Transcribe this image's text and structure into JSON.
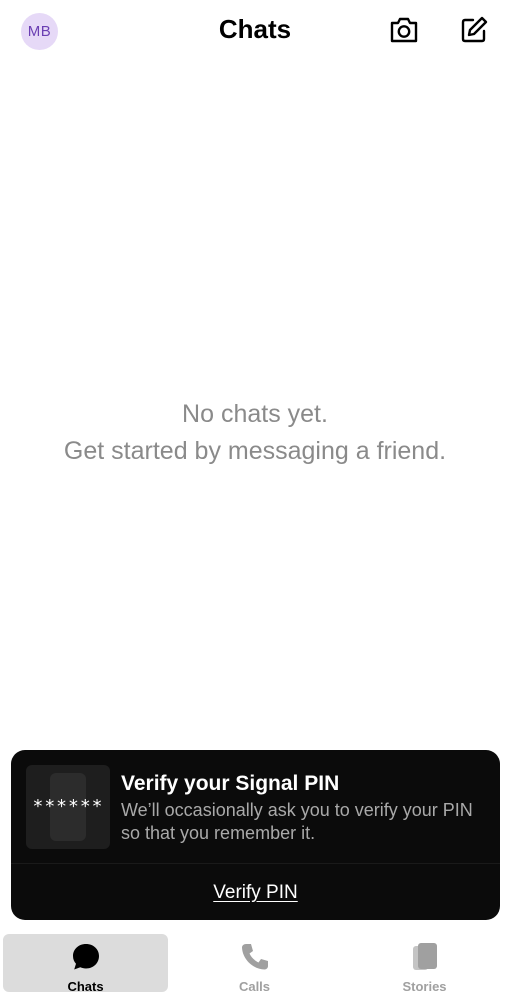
{
  "header": {
    "avatar_initials": "MB",
    "title": "Chats",
    "camera_icon": "camera-icon",
    "compose_icon": "compose-icon"
  },
  "empty_state": {
    "line1": "No chats yet.",
    "line2": "Get started by messaging a friend."
  },
  "pin_card": {
    "stars": "******",
    "title": "Verify your Signal PIN",
    "description": "We’ll occasionally ask you to verify your PIN so that you remember it.",
    "action_label": "Verify PIN"
  },
  "tabs": [
    {
      "label": "Chats",
      "icon": "chat-bubble-icon",
      "active": true
    },
    {
      "label": "Calls",
      "icon": "phone-icon",
      "active": false
    },
    {
      "label": "Stories",
      "icon": "stories-icon",
      "active": false
    }
  ],
  "colors": {
    "avatar_bg": "#e6d9f7",
    "avatar_text": "#6b3fb3",
    "card_bg": "#0b0b0b",
    "active_tab_bg": "#dcdcdc",
    "muted_text": "#8a8a8a"
  }
}
